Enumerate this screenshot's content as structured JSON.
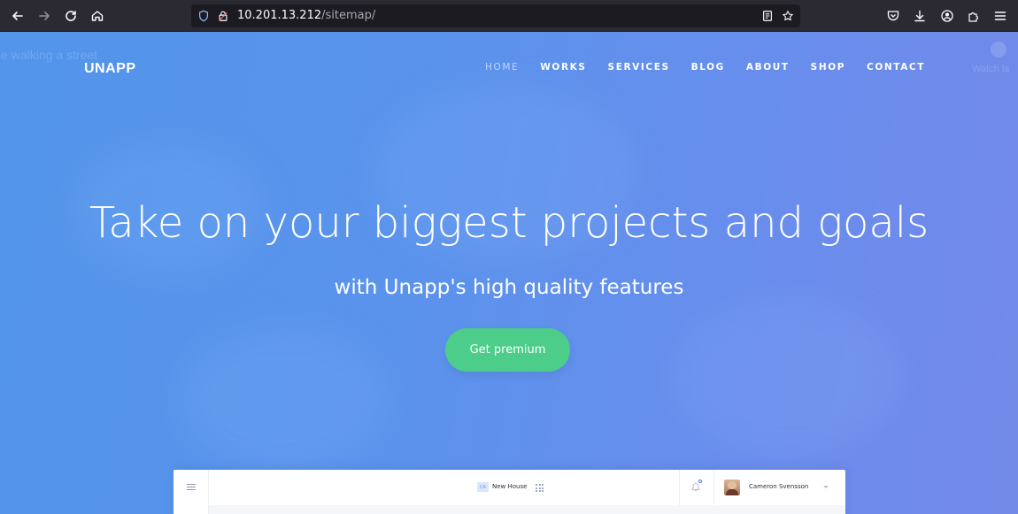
{
  "browser": {
    "url_host": "10.201.13.212",
    "url_path": "/sitemap/"
  },
  "site": {
    "logo": "UNAPP",
    "menu": [
      {
        "label": "HOME",
        "active": true
      },
      {
        "label": "WORKS",
        "active": false
      },
      {
        "label": "SERVICES",
        "active": false
      },
      {
        "label": "BLOG",
        "active": false
      },
      {
        "label": "ABOUT",
        "active": false
      },
      {
        "label": "SHOP",
        "active": false
      },
      {
        "label": "CONTACT",
        "active": false
      }
    ],
    "background_overlay_text": "le walking a street",
    "background_overlay_watch": "Watch la"
  },
  "hero": {
    "title": "Take on your biggest projects and goals",
    "subtitle": "with Unapp's high quality features",
    "cta_label": "Get premium"
  },
  "mockup": {
    "badge": "CA",
    "project_name": "New House",
    "user_name": "Cameron Svensson"
  },
  "colors": {
    "accent_green": "#4ccd8a",
    "hero_blue": "#5a93ec",
    "chrome": "#2b2a33"
  }
}
